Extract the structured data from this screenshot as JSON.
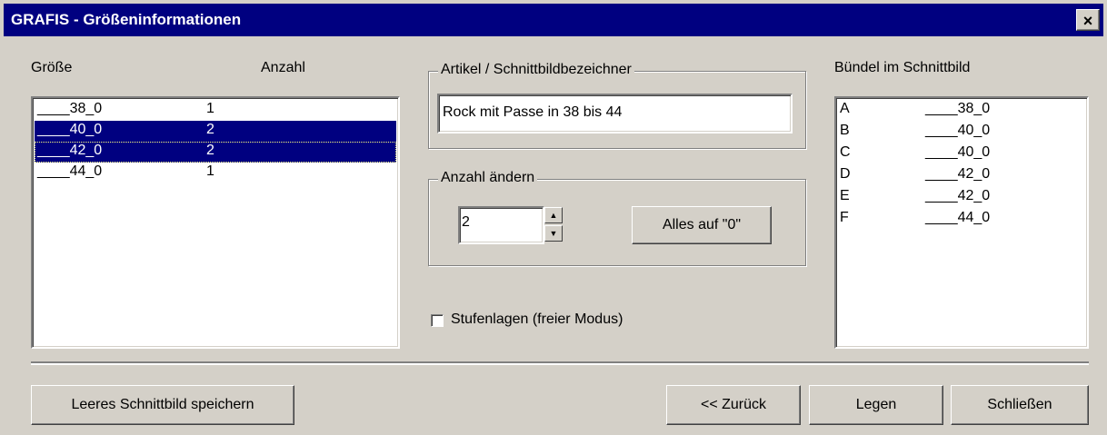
{
  "window": {
    "title": "GRAFIS - Größeninformationen",
    "close_icon": "×"
  },
  "sizes_panel": {
    "col_size": "Größe",
    "col_count": "Anzahl",
    "rows": [
      {
        "size": "____38_0",
        "count": "1",
        "selected": false
      },
      {
        "size": "____40_0",
        "count": "2",
        "selected": true
      },
      {
        "size": "____42_0",
        "count": "2",
        "selected": true
      },
      {
        "size": "____44_0",
        "count": "1",
        "selected": false
      }
    ]
  },
  "article": {
    "group_label": "Artikel / Schnittbildbezeichner",
    "value": "Rock mit Passe in 38 bis 44"
  },
  "change_count": {
    "group_label": "Anzahl ändern",
    "value": "2",
    "spin_up": "▲",
    "spin_down": "▼",
    "reset_label": "Alles auf \"0\""
  },
  "stufenlagen": {
    "label": "Stufenlagen (freier Modus)",
    "checked": false
  },
  "bundles": {
    "label": "Bündel im Schnittbild",
    "rows": [
      {
        "id": "A",
        "size": "____38_0"
      },
      {
        "id": "B",
        "size": "____40_0"
      },
      {
        "id": "C",
        "size": "____40_0"
      },
      {
        "id": "D",
        "size": "____42_0"
      },
      {
        "id": "E",
        "size": "____42_0"
      },
      {
        "id": "F",
        "size": "____44_0"
      }
    ]
  },
  "buttons": {
    "save_empty": "Leeres Schnittbild speichern",
    "back": "<< Zurück",
    "lay": "Legen",
    "close": "Schließen"
  }
}
